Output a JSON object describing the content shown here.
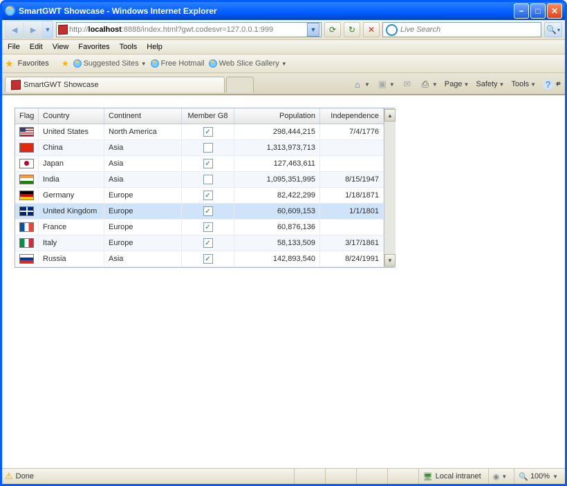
{
  "window": {
    "title": "SmartGWT Showcase - Windows Internet Explorer"
  },
  "nav": {
    "url_prefix": "http://",
    "url_host": "localhost",
    "url_rest": ":8888/index.html?gwt.codesvr=127.0.0.1:999",
    "search_placeholder": "Live Search"
  },
  "menu": [
    "File",
    "Edit",
    "View",
    "Favorites",
    "Tools",
    "Help"
  ],
  "favbar": {
    "label": "Favorites",
    "suggested": "Suggested Sites",
    "hotmail": "Free Hotmail",
    "webslice": "Web Slice Gallery"
  },
  "tab": {
    "label": "SmartGWT Showcase"
  },
  "cmdbar": {
    "page": "Page",
    "safety": "Safety",
    "tools": "Tools"
  },
  "grid": {
    "headers": {
      "flag": "Flag",
      "country": "Country",
      "continent": "Continent",
      "g8": "Member G8",
      "population": "Population",
      "independence": "Independence"
    },
    "rows": [
      {
        "flag": "us",
        "country": "United States",
        "continent": "North America",
        "g8": true,
        "population": "298,444,215",
        "independence": "7/4/1776",
        "alt": false,
        "sel": false
      },
      {
        "flag": "cn",
        "country": "China",
        "continent": "Asia",
        "g8": false,
        "population": "1,313,973,713",
        "independence": "",
        "alt": true,
        "sel": false
      },
      {
        "flag": "jp",
        "country": "Japan",
        "continent": "Asia",
        "g8": true,
        "population": "127,463,611",
        "independence": "",
        "alt": false,
        "sel": false
      },
      {
        "flag": "in",
        "country": "India",
        "continent": "Asia",
        "g8": false,
        "population": "1,095,351,995",
        "independence": "8/15/1947",
        "alt": true,
        "sel": false
      },
      {
        "flag": "de",
        "country": "Germany",
        "continent": "Europe",
        "g8": true,
        "population": "82,422,299",
        "independence": "1/18/1871",
        "alt": false,
        "sel": false
      },
      {
        "flag": "gb",
        "country": "United Kingdom",
        "continent": "Europe",
        "g8": true,
        "population": "60,609,153",
        "independence": "1/1/1801",
        "alt": true,
        "sel": true
      },
      {
        "flag": "fr",
        "country": "France",
        "continent": "Europe",
        "g8": true,
        "population": "60,876,136",
        "independence": "",
        "alt": false,
        "sel": false
      },
      {
        "flag": "it",
        "country": "Italy",
        "continent": "Europe",
        "g8": true,
        "population": "58,133,509",
        "independence": "3/17/1861",
        "alt": true,
        "sel": false
      },
      {
        "flag": "ru",
        "country": "Russia",
        "continent": "Asia",
        "g8": true,
        "population": "142,893,540",
        "independence": "8/24/1991",
        "alt": false,
        "sel": false
      }
    ]
  },
  "status": {
    "text": "Done",
    "zone": "Local intranet",
    "zoom": "100%"
  }
}
